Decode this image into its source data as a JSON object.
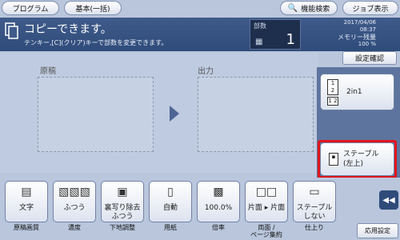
{
  "header": {
    "program_label": "プログラム",
    "basic_label": "基本(一括)",
    "func_search_label": "機能検索",
    "job_display_label": "ジョブ表示"
  },
  "status": {
    "title": "コピーできます。",
    "subtitle": "テンキー,[C](クリア)キーで部数を変更できます。",
    "copies_label": "部数",
    "copies_value": "1",
    "date": "2017/04/06",
    "time": "08:37",
    "memory_label": "メモリー残量",
    "memory_value": "100 %"
  },
  "main": {
    "confirm_label": "設定確認",
    "original_label": "原稿",
    "output_label": "出力"
  },
  "side": {
    "combine_label": "2in1",
    "staple_label_1": "ステープル",
    "staple_label_2": "(左上)"
  },
  "tiles": [
    {
      "label": "文字",
      "caption": "原稿画質"
    },
    {
      "label": "ふつう",
      "caption": "濃度"
    },
    {
      "label_1": "裏写り除去",
      "label_2": "ふつう",
      "caption": "下地調整"
    },
    {
      "label": "自動",
      "caption": "用紙"
    },
    {
      "label": "100.0%",
      "caption": "倍率"
    },
    {
      "label": "片面 ▸ 片面",
      "caption_1": "両面 /",
      "caption_2": "ページ集約"
    },
    {
      "label_1": "ステープル",
      "label_2": "しない",
      "caption": "仕上り"
    }
  ],
  "footer": {
    "apply_label": "応用設定"
  },
  "colors": {
    "background": "#b9c6dc",
    "status_bar": "#2f4b7a",
    "highlight": "#e0141c"
  }
}
